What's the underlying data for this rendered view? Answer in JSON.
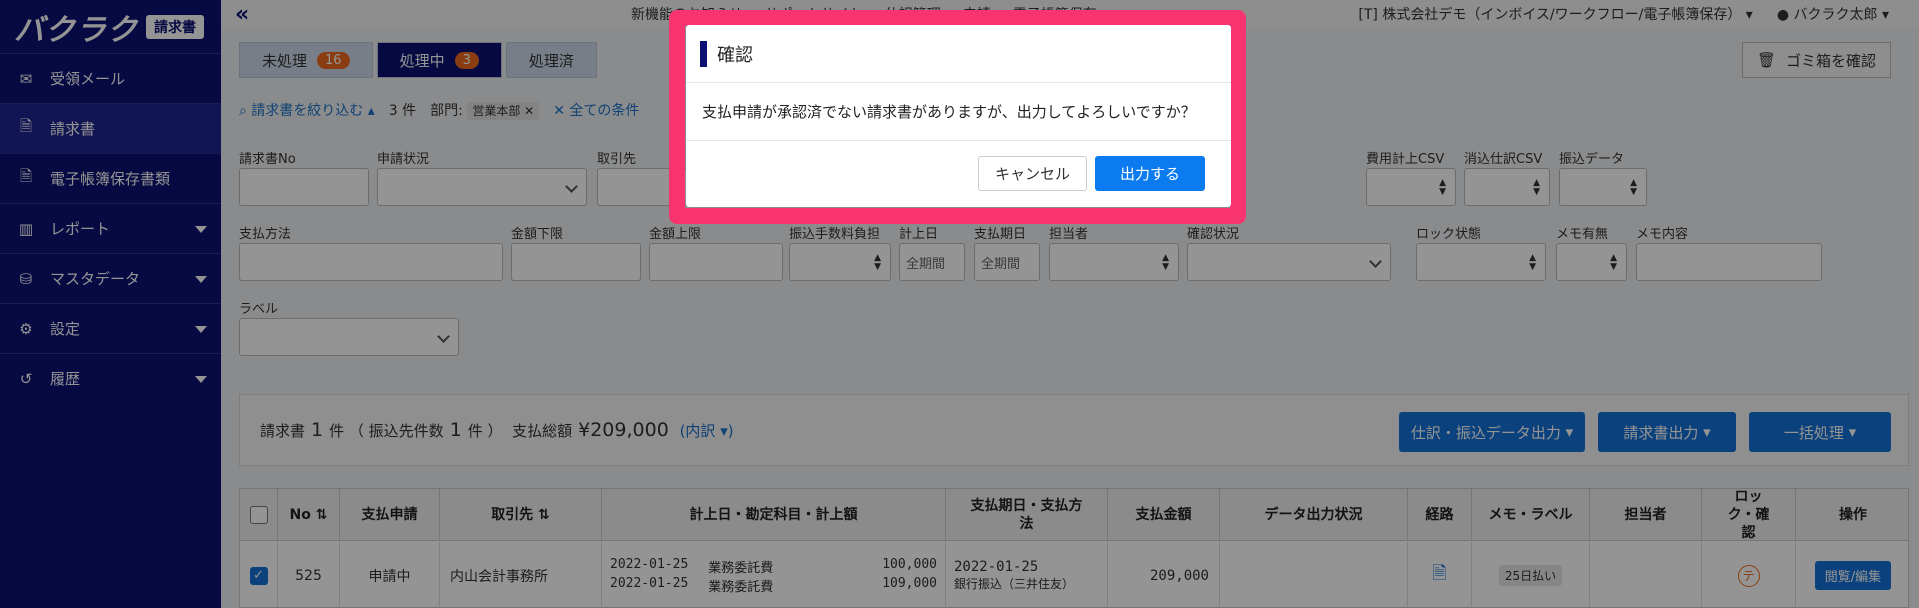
{
  "app": {
    "logo": "バクラク",
    "logo_badge": "請求書"
  },
  "sidebar": {
    "items": [
      {
        "label": "受領メール",
        "icon": "mail-icon",
        "caret": false,
        "active": false
      },
      {
        "label": "請求書",
        "icon": "document-icon",
        "caret": false,
        "active": true
      },
      {
        "label": "電子帳簿保存書類",
        "icon": "document-icon",
        "caret": false,
        "active": false
      },
      {
        "label": "レポート",
        "icon": "bar-chart-icon",
        "caret": true,
        "active": false
      },
      {
        "label": "マスタデータ",
        "icon": "database-icon",
        "caret": true,
        "active": false
      },
      {
        "label": "設定",
        "icon": "gear-icon",
        "caret": true,
        "active": false
      },
      {
        "label": "履歴",
        "icon": "history-icon",
        "caret": true,
        "active": false
      }
    ]
  },
  "topbar": {
    "items": [
      "新機能のお知らせ",
      "サポートサイト",
      "仕訳管理",
      "申請",
      "電子帳簿保存"
    ],
    "company": "[T] 株式会社デモ（インボイス/ワークフロー/電子帳簿保存）",
    "user": "バクラク太郎"
  },
  "tabs": [
    {
      "label": "未処理",
      "count": "16"
    },
    {
      "label": "処理中",
      "count": "3"
    },
    {
      "label": "処理済",
      "count": ""
    }
  ],
  "trash_button": "ゴミ箱を確認",
  "filterbar": {
    "toggle": "請求書を絞り込む",
    "count": "3 件",
    "dept_label": "部門:",
    "dept_chip": "営業本部",
    "clear_all": "全ての条件"
  },
  "filters_row1": [
    "請求書No",
    "申請状況",
    "取引先",
    "費用計上CSV",
    "消込仕訳CSV",
    "振込データ"
  ],
  "filters_row2": [
    "支払方法",
    "金額下限",
    "金額上限",
    "振込手数料負担",
    "計上日",
    "支払期日",
    "担当者",
    "確認状況",
    "ロック状態",
    "メモ有無",
    "メモ内容"
  ],
  "filters_row3": [
    "ラベル"
  ],
  "date_placeholder": "全期間",
  "summary": {
    "invoices_label": "請求書",
    "invoices_count": "1",
    "unit": "件",
    "payees_label": "（ 振込先件数",
    "payees_count": "1",
    "payees_close": "件 ）",
    "total_label": "支払総額",
    "total_value": "¥209,000",
    "breakdown": "(内訳"
  },
  "action_buttons": [
    "仕訳・振込データ出力",
    "請求書出力",
    "一括処理"
  ],
  "table": {
    "headers": [
      "No",
      "支払申請",
      "取引先",
      "計上日・勘定科目・計上額",
      "支払期日・支払方法",
      "支払金額",
      "データ出力状況",
      "経路",
      "メモ・ラベル",
      "担当者",
      "ロック・確認",
      "操作"
    ],
    "row": {
      "no": "525",
      "status": "申請中",
      "vendor": "内山会計事務所",
      "lines": [
        {
          "date": "2022-01-25",
          "account": "業務委託費",
          "amount": "100,000"
        },
        {
          "date": "2022-01-25",
          "account": "業務委託費",
          "amount": "109,000"
        }
      ],
      "due_date": "2022-01-25",
      "pay_method": "銀行振込（三井住友）",
      "pay_amount": "209,000",
      "label": "25日払い",
      "lock_mark": "テ",
      "edit_button": "閲覧/編集"
    }
  },
  "modal": {
    "title": "確認",
    "message": "支払申請が承認済でない請求書がありますが、出力してよろしいですか？",
    "cancel": "キャンセル",
    "ok": "出力する"
  },
  "colors": {
    "navy": "#0c1073",
    "accent": "#1371d6",
    "highlight": "#f7346f",
    "badge": "#ec6a1c"
  }
}
